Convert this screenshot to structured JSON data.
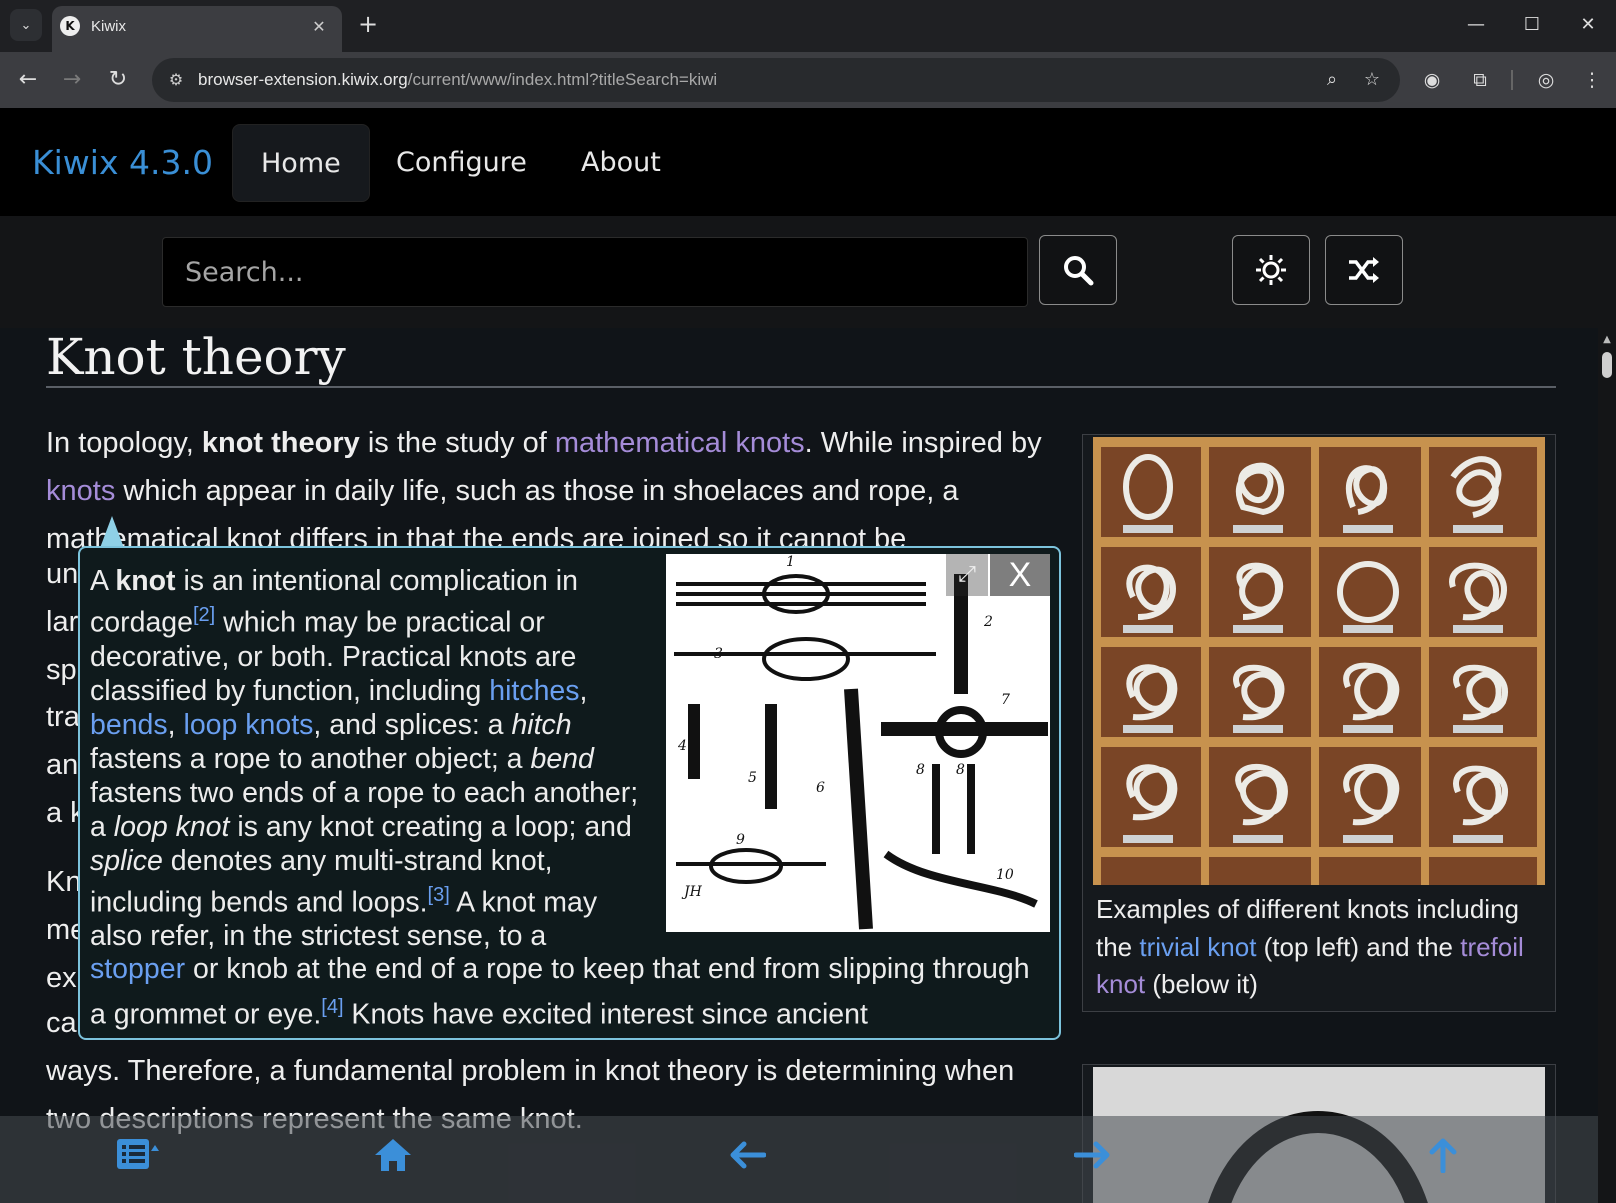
{
  "browser": {
    "tab_title": "Kiwix",
    "url_host": "browser-extension.kiwix.org",
    "url_path": "/current/www/index.html?titleSearch=kiwi",
    "icons": [
      "tab-search-icon",
      "close-icon",
      "plus-icon",
      "minimize-icon",
      "maximize-icon",
      "window-close-icon",
      "back-arrow-icon",
      "forward-arrow-icon",
      "reload-icon",
      "site-info-icon",
      "zoom-icon",
      "star-icon",
      "extension-icon",
      "puzzle-icon",
      "profile-icon",
      "kebab-menu-icon"
    ]
  },
  "app": {
    "brand": "Kiwix 4.3.0",
    "nav": [
      {
        "label": "Home",
        "active": true
      },
      {
        "label": "Configure",
        "active": false
      },
      {
        "label": "About",
        "active": false
      }
    ],
    "search": {
      "placeholder": "Search..."
    },
    "accent_color": "#3a8fd6"
  },
  "article": {
    "title": "Knot theory",
    "p1_parts": {
      "a": "In topology, ",
      "b": "knot theory",
      "c": " is the study of ",
      "link1": "mathematical knots",
      "d": ". While inspired by ",
      "link2": "knots",
      "e": " which appear in daily life, such as those in shoelaces and rope, a mathematical knot differs in that the ends are joined so it cannot be"
    },
    "left_fragments": [
      "un",
      "lar",
      "sp",
      "tra",
      "an",
      "a k"
    ],
    "p2_fragments": [
      "Kn",
      "me",
      "ex"
    ],
    "p2_tail": "called a knot diagram, in which any knot can be drawn in many different ways. Therefore, a fundamental problem in knot theory is determining when two descriptions represent the same knot.",
    "infobox_caption": {
      "a": "Examples of different knots including the ",
      "link1": "trivial knot",
      "b": " (top left) and the ",
      "link2": "trefoil knot",
      "c": " (below it)"
    }
  },
  "popover": {
    "s1": "A ",
    "s1b": "knot",
    "s2": " is an intentional complication in cordage",
    "ref2": "[2]",
    "s3": " which may be practical or decorative, or both. Practical knots are classified by function, including ",
    "l_hitches": "hitches",
    "c1": ", ",
    "l_bends": "bends",
    "c2": ", ",
    "l_loop": "loop knots",
    "s4": ", and splices: a ",
    "i_hitch": "hitch",
    "s5": " fastens a rope to another object; a ",
    "i_bend": "bend",
    "s6": " fastens two ends of a rope to each another; a ",
    "i_loop": "loop knot",
    "s7": " is any knot creating a loop; and ",
    "i_splice": "splice",
    "s8": " denotes any multi-strand knot, including bends and loops.",
    "ref3": "[3]",
    "s9": " A knot may also refer, in the strictest sense, to a",
    "l_stopper": "stopper",
    "s10": " or knob at the end of a rope to keep that end from slipping through a grommet or eye.",
    "ref4": "[4]",
    "s11": " Knots have excited interest since ancient",
    "close_label": "X",
    "figure_numbers": [
      "1",
      "2",
      "3",
      "4",
      "5",
      "6",
      "7",
      "8",
      "8",
      "9",
      "10",
      "JH"
    ]
  },
  "bottom_toolbar": {
    "icons": [
      "table-of-contents-icon",
      "home-icon",
      "back-arrow-icon",
      "forward-arrow-icon",
      "up-arrow-icon"
    ]
  }
}
